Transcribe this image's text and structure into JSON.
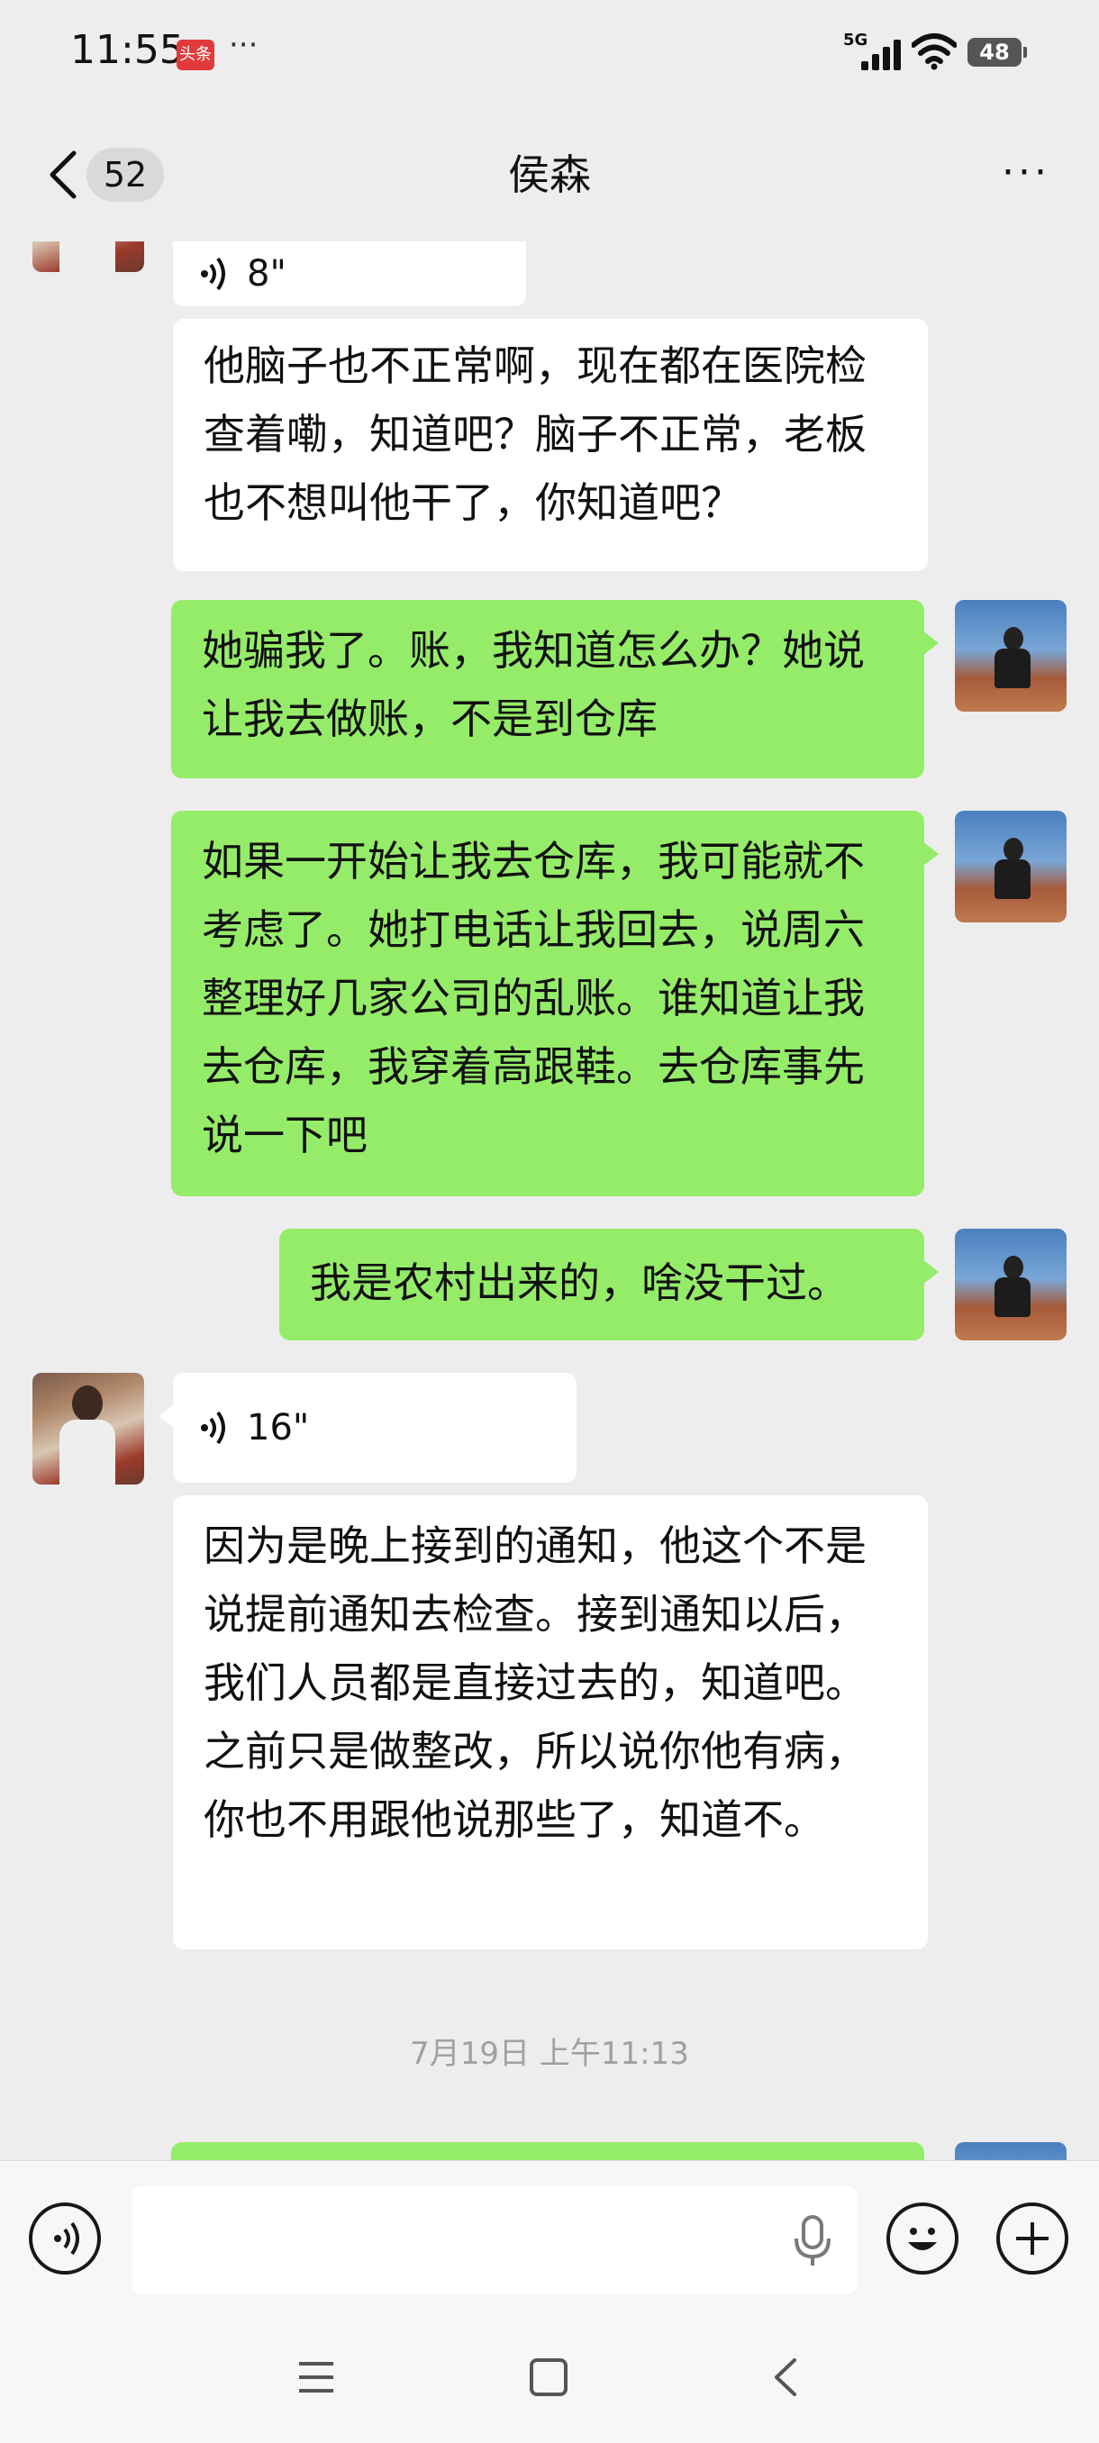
{
  "status": {
    "time": "11:55",
    "app_badge": "头条",
    "more_dots": "···",
    "network": "5G",
    "battery": "48"
  },
  "header": {
    "unread_count": "52",
    "title": "侯森",
    "menu": "···"
  },
  "messages": [
    {
      "side": "left",
      "type": "voice",
      "duration": "8\""
    },
    {
      "side": "left",
      "type": "text",
      "text": "他脑子也不正常啊，现在都在医院检查着嘞，知道吧？脑子不正常，老板也不想叫他干了，你知道吧？"
    },
    {
      "side": "right",
      "type": "text",
      "text": "她骗我了。账，我知道怎么办？她说让我去做账，不是到仓库"
    },
    {
      "side": "right",
      "type": "text",
      "text": "如果一开始让我去仓库，我可能就不考虑了。她打电话让我回去，说周六整理好几家公司的乱账。谁知道让我去仓库，我穿着高跟鞋。去仓库事先说一下吧"
    },
    {
      "side": "right",
      "type": "text",
      "text": "我是农村出来的，啥没干过。"
    },
    {
      "side": "left",
      "type": "voice",
      "duration": "16\""
    },
    {
      "side": "left",
      "type": "text",
      "text": "因为是晚上接到的通知，他这个不是说提前通知去检查。接到通知以后，我们人员都是直接过去的，知道吧。之前只是做整改，所以说你他有病，你也不用跟他说那些了，知道不。"
    }
  ],
  "timestamp": "7月19日 上午11:13",
  "input": {
    "placeholder": ""
  },
  "colors": {
    "background": "#ededed",
    "bubble_self": "#95ec69",
    "bubble_other": "#ffffff"
  }
}
